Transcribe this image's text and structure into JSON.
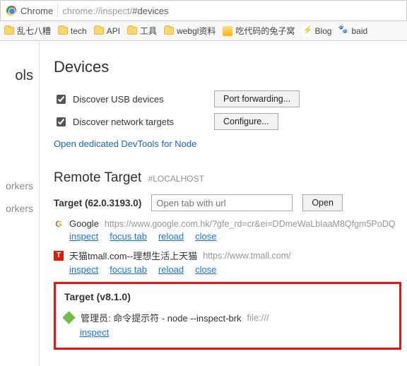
{
  "address_bar": {
    "scheme_label": "Chrome",
    "url_gray": "chrome://inspect/",
    "url_dark": "#devices"
  },
  "bookmarks": [
    {
      "type": "folder",
      "label": "乱七八糟"
    },
    {
      "type": "folder",
      "label": "tech"
    },
    {
      "type": "folder",
      "label": "API"
    },
    {
      "type": "folder",
      "label": "工具"
    },
    {
      "type": "folder",
      "label": "webgl资料"
    },
    {
      "type": "fav",
      "icon": "pika",
      "label": "吃代码的兔子窝"
    },
    {
      "type": "fav",
      "icon": "bolt",
      "label": "Blog"
    },
    {
      "type": "fav",
      "icon": "paw",
      "label": "baid"
    }
  ],
  "sidebar": {
    "title_fragment": "ols",
    "items": [
      "orkers",
      "orkers"
    ]
  },
  "devices": {
    "heading": "Devices",
    "usb_label": "Discover USB devices",
    "usb_checked": true,
    "net_label": "Discover network targets",
    "net_checked": true,
    "port_btn": "Port forwarding...",
    "configure_btn": "Configure...",
    "node_link": "Open dedicated DevTools for Node"
  },
  "remote": {
    "heading": "Remote Target",
    "tag": "#LOCALHOST",
    "target_label": "Target (62.0.3193.0)",
    "open_placeholder": "Open tab with url",
    "open_btn": "Open",
    "entries": [
      {
        "icon": "google",
        "title": "Google",
        "url": "https://www.google.com.hk/?gfe_rd=cr&ei=DDmeWaLbIaaM8Qfgm5PoDQ",
        "actions": [
          "inspect",
          "focus tab",
          "reload",
          "close"
        ]
      },
      {
        "icon": "tmall",
        "title": "天猫tmall.com--理想生活上天猫",
        "url": "https://www.tmall.com/",
        "actions": [
          "inspect",
          "focus tab",
          "reload",
          "close"
        ]
      }
    ]
  },
  "node_target": {
    "label": "Target (v8.1.0)",
    "title": "管理员: 命令提示符 - node --inspect-brk",
    "scheme": "file:///",
    "action": "inspect"
  }
}
